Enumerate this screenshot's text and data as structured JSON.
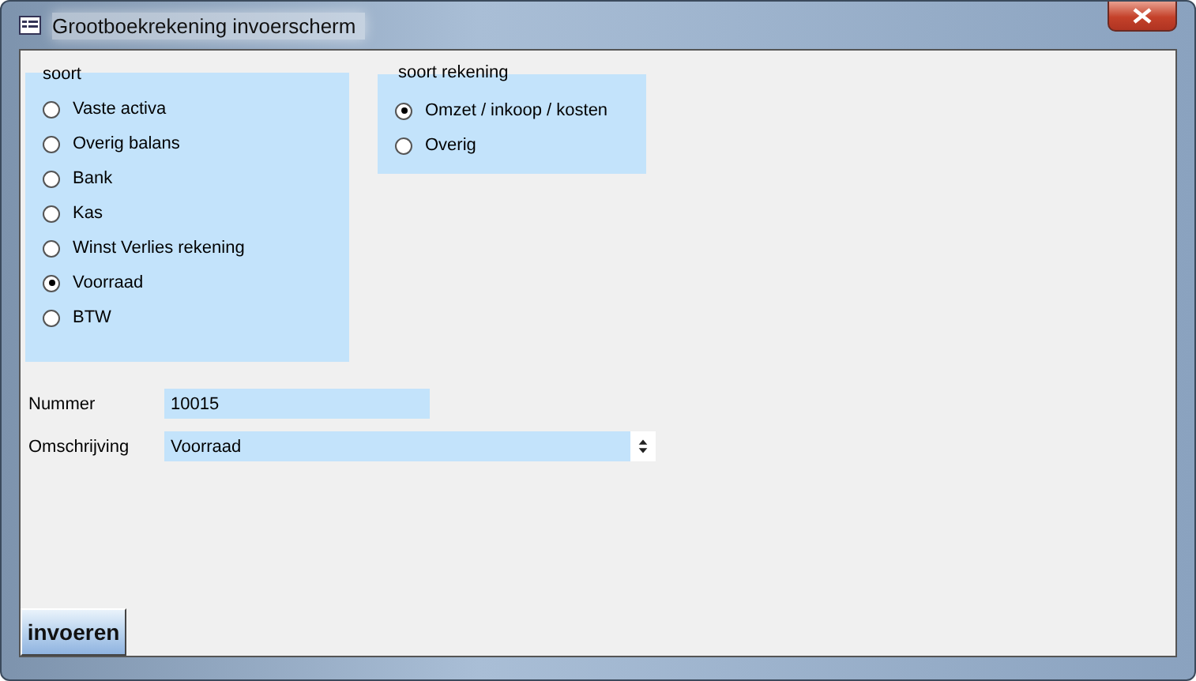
{
  "window": {
    "title": "Grootboekrekening invoerscherm"
  },
  "groups": [
    {
      "label": "soort",
      "options": [
        {
          "label": "Vaste activa",
          "selected": false
        },
        {
          "label": "Overig balans",
          "selected": false
        },
        {
          "label": "Bank",
          "selected": false
        },
        {
          "label": "Kas",
          "selected": false
        },
        {
          "label": "Winst Verlies rekening",
          "selected": false
        },
        {
          "label": "Voorraad",
          "selected": true
        },
        {
          "label": "BTW",
          "selected": false
        }
      ]
    },
    {
      "label": "soort rekening",
      "options": [
        {
          "label": "Omzet / inkoop / kosten",
          "selected": true
        },
        {
          "label": "Overig",
          "selected": false
        }
      ]
    }
  ],
  "fields": [
    {
      "label": "Nummer",
      "value": "10015",
      "kind": "text"
    },
    {
      "label": "Omschrijving",
      "value": "Voorraad",
      "kind": "spinner"
    }
  ],
  "buttons": [
    "invoeren"
  ]
}
